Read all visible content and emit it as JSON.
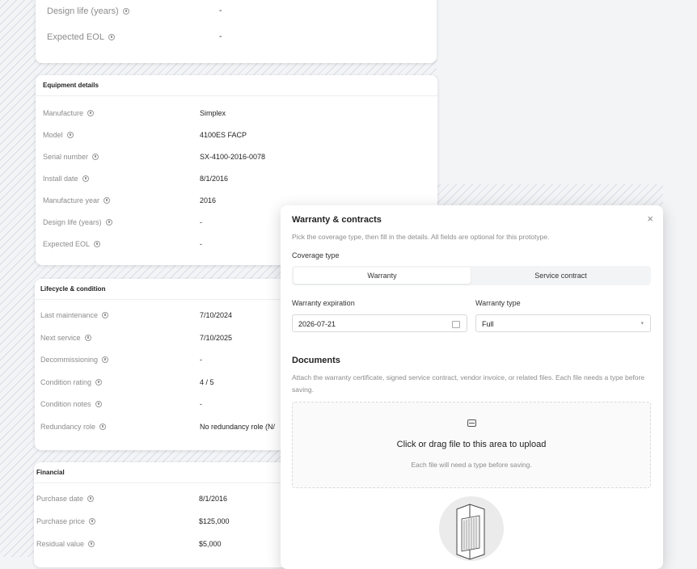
{
  "top_card": {
    "rows": [
      {
        "label": "Design life (years)",
        "value": "-"
      },
      {
        "label": "Expected EOL",
        "value": "-"
      }
    ]
  },
  "equipment": {
    "title": "Equipment details",
    "rows": [
      {
        "label": "Manufacture",
        "value": "Simplex"
      },
      {
        "label": "Model",
        "value": "4100ES FACP"
      },
      {
        "label": "Serial number",
        "value": "SX-4100-2016-0078"
      },
      {
        "label": "Install date",
        "value": "8/1/2016"
      },
      {
        "label": "Manufacture year",
        "value": "2016"
      },
      {
        "label": "Design life (years)",
        "value": "-"
      },
      {
        "label": "Expected EOL",
        "value": "-"
      }
    ]
  },
  "lifecycle": {
    "title": "Lifecycle & condition",
    "rows": [
      {
        "label": "Last maintenance",
        "value": "7/10/2024"
      },
      {
        "label": "Next service",
        "value": "7/10/2025"
      },
      {
        "label": "Decommissioning",
        "value": "-"
      },
      {
        "label": "Condition rating",
        "value": "4 / 5"
      },
      {
        "label": "Condition notes",
        "value": "-"
      },
      {
        "label": "Redundancy role",
        "value": "No redundancy role (N/"
      }
    ]
  },
  "financial": {
    "title": "Financial",
    "rows": [
      {
        "label": "Purchase date",
        "value": "8/1/2016"
      },
      {
        "label": "Purchase price",
        "value": "$125,000"
      },
      {
        "label": "Residual value",
        "value": "$5,000"
      }
    ]
  },
  "modal": {
    "title": "Warranty & contracts",
    "close": "×",
    "subtitle": "Pick the coverage type, then fill in the details. All fields are optional for this prototype.",
    "coverage_label": "Coverage type",
    "coverage_options": [
      "Warranty",
      "Service contract"
    ],
    "coverage_selected": "Warranty",
    "expiration_label": "Warranty expiration",
    "expiration_value": "2026-07-21",
    "type_label": "Warranty type",
    "type_value": "Full",
    "documents_title": "Documents",
    "documents_sub": "Attach the warranty certificate, signed service contract, vendor invoice, or related files. Each file needs a type before saving.",
    "upload_main": "Click or drag file to this area to upload",
    "upload_sub": "Each file will need a type before saving."
  },
  "colors": {
    "accent_stripes": "#d9dce6",
    "card_bg": "#ffffff",
    "muted_text": "#8c8c8c"
  }
}
